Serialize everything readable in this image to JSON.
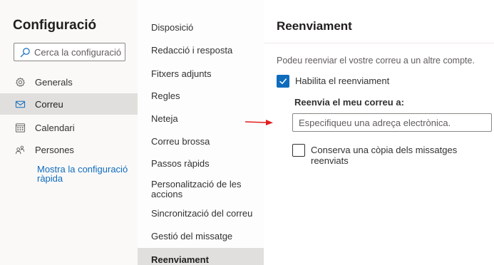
{
  "settings": {
    "title": "Configuració",
    "search_placeholder": "Cerca la configuració",
    "nav": [
      {
        "label": "Generals",
        "icon": "gear-icon",
        "active": false
      },
      {
        "label": "Correu",
        "icon": "mail-icon",
        "active": true
      },
      {
        "label": "Calendari",
        "icon": "calendar-icon",
        "active": false
      },
      {
        "label": "Persones",
        "icon": "people-icon",
        "active": false
      }
    ],
    "quick_settings_link": "Mostra la configuració ràpida"
  },
  "mail_sections": [
    "Disposició",
    "Redacció i resposta",
    "Fitxers adjunts",
    "Regles",
    "Neteja",
    "Correu brossa",
    "Passos ràpids",
    "Personalització de les accions",
    "Sincronització del correu",
    "Gestió del missatge",
    "Reenviament"
  ],
  "active_section": "Reenviament",
  "forwarding": {
    "title": "Reenviament",
    "description": "Podeu reenviar el vostre correu a un altre compte.",
    "enable_label": "Habilita el reenviament",
    "enable_checked": true,
    "forward_to_label": "Reenvia el meu correu a:",
    "email_placeholder": "Especifiqueu una adreça electrònica.",
    "email_value": "",
    "keep_copy_label": "Conserva una còpia dels missatges reenviats",
    "keep_copy_checked": false
  },
  "colors": {
    "accent": "#0f6cbd",
    "annotation_arrow": "#e02020"
  }
}
